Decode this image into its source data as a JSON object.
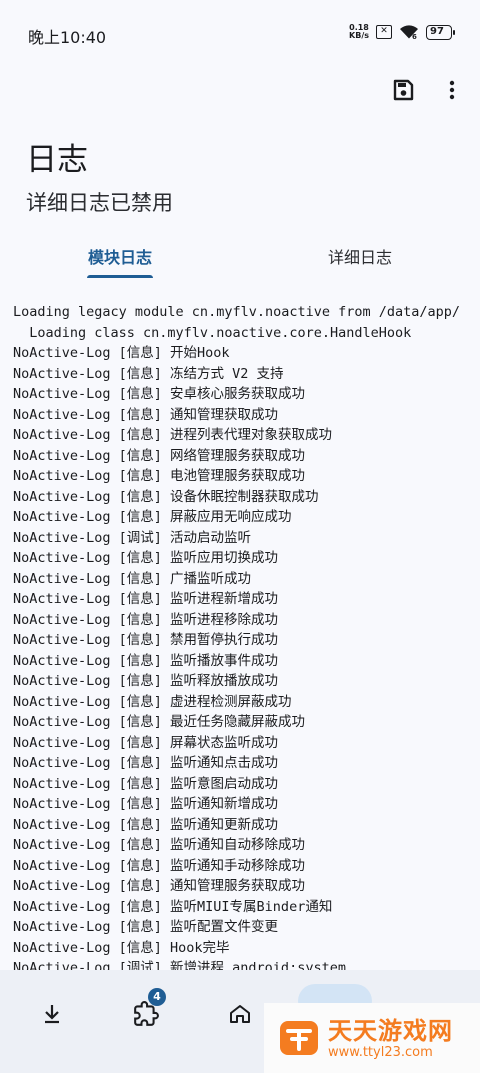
{
  "status_bar": {
    "time": "晚上10:40",
    "net_speed_value": "0.18",
    "net_speed_unit": "KB/s",
    "battery": "97"
  },
  "toolbar": {
    "save_icon": "save-icon",
    "more_icon": "more-vert-icon"
  },
  "header": {
    "title": "日志",
    "subtitle": "详细日志已禁用"
  },
  "tabs": [
    {
      "label": "模块日志",
      "active": true
    },
    {
      "label": "详细日志",
      "active": false
    }
  ],
  "log_lines": [
    "Loading legacy module cn.myflv.noactive from /data/app/",
    "  Loading class cn.myflv.noactive.core.HandleHook",
    "NoActive-Log [信息] 开始Hook",
    "NoActive-Log [信息] 冻结方式 V2 支持",
    "NoActive-Log [信息] 安卓核心服务获取成功",
    "NoActive-Log [信息] 通知管理获取成功",
    "NoActive-Log [信息] 进程列表代理对象获取成功",
    "NoActive-Log [信息] 网络管理服务获取成功",
    "NoActive-Log [信息] 电池管理服务获取成功",
    "NoActive-Log [信息] 设备休眠控制器获取成功",
    "NoActive-Log [信息] 屏蔽应用无响应成功",
    "NoActive-Log [调试] 活动启动监听",
    "NoActive-Log [信息] 监听应用切换成功",
    "NoActive-Log [信息] 广播监听成功",
    "NoActive-Log [信息] 监听进程新增成功",
    "NoActive-Log [信息] 监听进程移除成功",
    "NoActive-Log [信息] 禁用暂停执行成功",
    "NoActive-Log [信息] 监听播放事件成功",
    "NoActive-Log [信息] 监听释放播放成功",
    "NoActive-Log [信息] 虚进程检测屏蔽成功",
    "NoActive-Log [信息] 最近任务隐藏屏蔽成功",
    "NoActive-Log [信息] 屏幕状态监听成功",
    "NoActive-Log [信息] 监听通知点击成功",
    "NoActive-Log [信息] 监听意图启动成功",
    "NoActive-Log [信息] 监听通知新增成功",
    "NoActive-Log [信息] 监听通知更新成功",
    "NoActive-Log [信息] 监听通知自动移除成功",
    "NoActive-Log [信息] 监听通知手动移除成功",
    "NoActive-Log [信息] 通知管理服务获取成功",
    "NoActive-Log [信息] 监听MIUI专属Binder通知",
    "NoActive-Log [信息] 监听配置文件变更",
    "NoActive-Log [信息] Hook完毕",
    "NoActive-Log [调试] 新增进程 android:system"
  ],
  "bottom_nav": {
    "items": [
      {
        "icon": "download-icon"
      },
      {
        "icon": "extension-icon",
        "badge": "4"
      },
      {
        "icon": "home-icon"
      },
      {
        "icon": "logs-icon",
        "active": true
      },
      {
        "icon": "settings-icon"
      }
    ]
  },
  "watermark": {
    "title": "天天游戏网",
    "url": "www.ttyl23.com"
  },
  "colors": {
    "accent": "#1f5d94",
    "background": "#f8f9fd",
    "nav_background": "#edf0f6",
    "watermark_orange": "#f47c20"
  }
}
